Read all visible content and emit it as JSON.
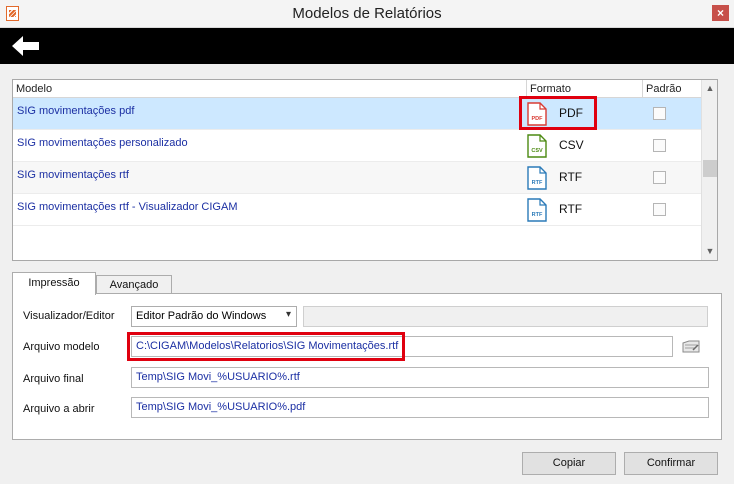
{
  "window": {
    "title": "Modelos de Relatórios",
    "close_glyph": "×"
  },
  "toolbar": {
    "back_icon": "arrow-left-icon"
  },
  "grid": {
    "columns": {
      "model": "Modelo",
      "format": "Formato",
      "default": "Padrão"
    },
    "rows": [
      {
        "name": "SIG movimentações pdf",
        "format": "PDF",
        "format_icon": "pdf-file-icon",
        "icon_text": "PDF",
        "color": "#d83b34",
        "default": false,
        "selected": true
      },
      {
        "name": "SIG movimentações personalizado",
        "format": "CSV",
        "format_icon": "csv-file-icon",
        "icon_text": "CSV",
        "color": "#4c8a12",
        "default": false,
        "selected": false
      },
      {
        "name": "SIG movimentações rtf",
        "format": "RTF",
        "format_icon": "rtf-file-icon",
        "icon_text": "RTF",
        "color": "#2a7ab8",
        "default": false,
        "selected": false
      },
      {
        "name": "SIG movimentações rtf - Visualizador CIGAM",
        "format": "RTF",
        "format_icon": "rtf-file-icon",
        "icon_text": "RTF",
        "color": "#2a7ab8",
        "default": false,
        "selected": false
      }
    ]
  },
  "tabs": [
    {
      "label": "Impressão"
    },
    {
      "label": "Avançado"
    }
  ],
  "form": {
    "viewer_label": "Visualizador/Editor",
    "viewer_value": "Editor Padrão do Windows",
    "model_file_label": "Arquivo modelo",
    "model_file_value": "C:\\CIGAM\\Modelos\\Relatorios\\SIG Movimentações.rtf",
    "final_file_label": "Arquivo final",
    "final_file_value": "Temp\\SIG Movi_%USUARIO%.rtf",
    "open_file_label": "Arquivo a abrir",
    "open_file_value": "Temp\\SIG Movi_%USUARIO%.pdf"
  },
  "buttons": {
    "copy": "Copiar",
    "confirm": "Confirmar"
  },
  "colors": {
    "highlight": "#e0000f",
    "selected_row": "#cde8ff",
    "link_text": "#1b2fa3",
    "toolbar": "#000000"
  }
}
